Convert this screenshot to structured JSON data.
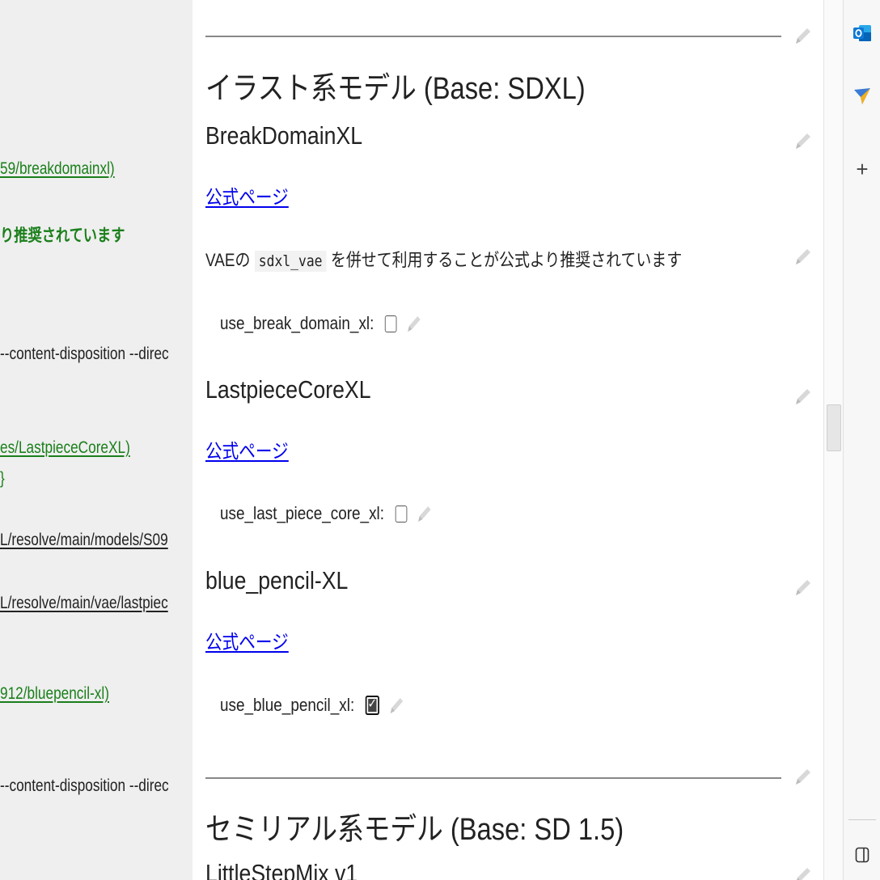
{
  "left_pane": {
    "lines": [
      {
        "text": "59/breakdomainxl)",
        "style": "link"
      },
      {
        "text": "り推奨されています",
        "style": "bold"
      },
      {
        "text": "--content-disposition --direc",
        "style": "code"
      },
      {
        "text": "es/LastpieceCoreXL)",
        "style": "link"
      },
      {
        "text": "}",
        "style": "green"
      },
      {
        "text": "L/resolve/main/models/S09",
        "style": "code-ul"
      },
      {
        "text": "L/resolve/main/vae/lastpiec",
        "style": "code-ul"
      },
      {
        "text": "912/bluepencil-xl)",
        "style": "link"
      },
      {
        "text": "--content-disposition --direc",
        "style": "code"
      }
    ]
  },
  "markdown": {
    "section1_title": "イラスト系モデル (Base: SDXL)",
    "models": [
      {
        "name": "BreakDomainXL",
        "link_label": "公式ページ",
        "note_prefix": "VAEの",
        "note_code": "sdxl_vae",
        "note_suffix": "を併せて利用することが公式より推奨されています",
        "param": "use_break_domain_xl:",
        "checked": false
      },
      {
        "name": "LastpieceCoreXL",
        "link_label": "公式ページ",
        "param": "use_last_piece_core_xl:",
        "checked": false
      },
      {
        "name": "blue_pencil-XL",
        "link_label": "公式ページ",
        "param": "use_blue_pencil_xl:",
        "checked": true
      }
    ],
    "section2_title": "セミリアル系モデル (Base: SD 1.5)",
    "next_model": "LittleStepMix v1"
  },
  "sidebar": {
    "icons": [
      "outlook-icon",
      "send-icon",
      "plus-icon",
      "sidebar-toggle-icon"
    ],
    "plus_glyph": "+"
  }
}
